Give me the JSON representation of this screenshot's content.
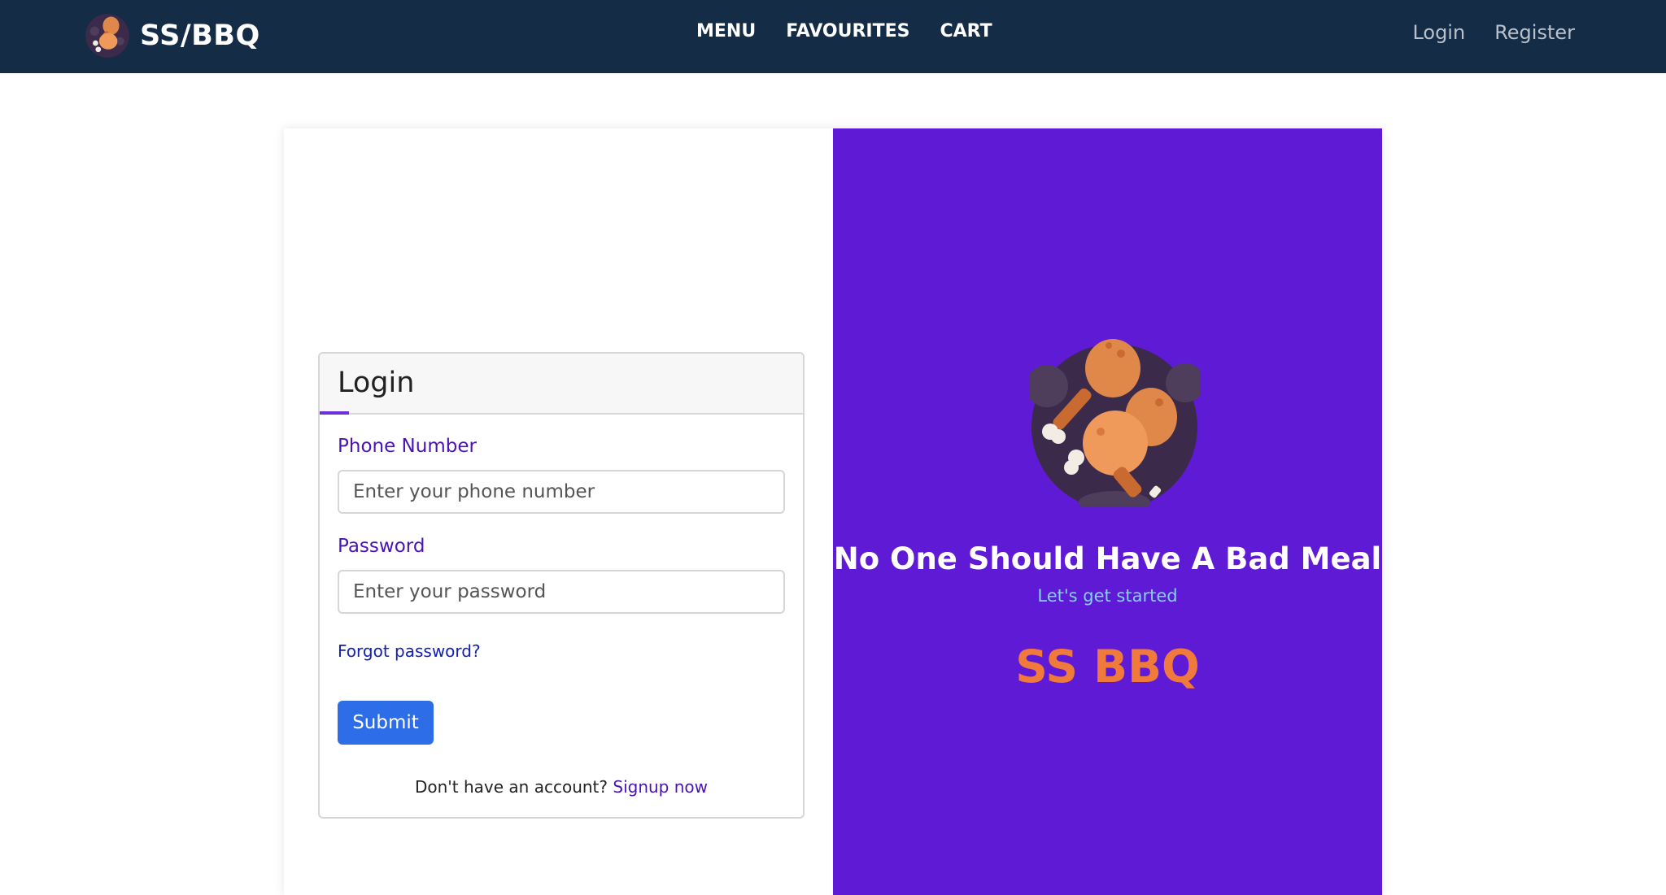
{
  "navbar": {
    "brand": "SS/BBQ",
    "links": [
      "MENU",
      "FAVOURITES",
      "CART"
    ],
    "login": "Login",
    "register": "Register"
  },
  "login": {
    "title": "Login",
    "phone_label": "Phone Number",
    "phone_placeholder": "Enter your phone number",
    "password_label": "Password",
    "password_placeholder": "Enter your password",
    "forgot": "Forgot password?",
    "submit": "Submit",
    "signup_prompt": "Don't have an account?",
    "signup_link": "Signup now"
  },
  "hero": {
    "title": "No One Should Have A Bad Meal",
    "subtitle": "Let's get started",
    "brand": "SS BBQ"
  },
  "colors": {
    "navbar_bg": "#142c46",
    "hero_bg": "#5f1ad6",
    "accent_orange": "#f07a3c",
    "submit_blue": "#2d6ee8",
    "label_purple": "#4a13b8"
  },
  "icons": {
    "brand_logo": "chicken-drumstick-icon",
    "hero_logo": "chicken-drumstick-icon"
  }
}
